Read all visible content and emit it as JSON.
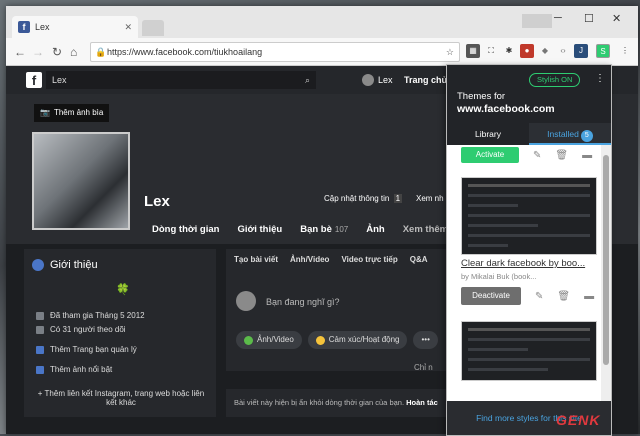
{
  "browser": {
    "tab_title": "Lex",
    "url": "https://www.facebook.com/tiukhoailang"
  },
  "fb": {
    "search_value": "Lex",
    "user_name": "Lex",
    "home_label": "Trang chủ",
    "cover_button": "Thêm ảnh bìa",
    "profile_name": "Lex",
    "update_info": "Cập nhật thông tin",
    "update_info_count": "1",
    "view_more": "Xem nh",
    "tabs": [
      {
        "label": "Dòng thời gian"
      },
      {
        "label": "Giới thiệu"
      },
      {
        "label": "Bạn bè",
        "count": "107"
      },
      {
        "label": "Ảnh"
      },
      {
        "label": "Xem thêm ▾"
      }
    ],
    "intro": {
      "heading": "Giới thiệu",
      "clover": "🍀",
      "joined": "Đã tham gia Tháng 5 2012",
      "followers": "Có 31 người theo dõi",
      "pages": "Thêm Trang bạn quản lý",
      "featured": "Thêm ảnh nổi bật",
      "links": "+ Thêm liên kết Instagram, trang web hoặc liên kết khác"
    },
    "composer": {
      "tabs": [
        "Tạo bài viết",
        "Ảnh/Video",
        "Video trực tiếp",
        "Q&A"
      ],
      "placeholder": "Bạn đang nghĩ gì?",
      "btn_photo": "Ảnh/Video",
      "btn_feeling": "Cảm xúc/Hoạt động",
      "btn_more": "•••",
      "privacy": "Chỉ n"
    },
    "hidden_note": "Bài viết này hiện bị ẩn khỏi dòng thời gian của bạn.",
    "hidden_done": "Hoàn tác"
  },
  "stylish": {
    "status": "Stylish ON",
    "title_line1": "Themes for",
    "title_line2": "www.facebook.com",
    "tab_library": "Library",
    "tab_installed": "Installed",
    "installed_count": "5",
    "activate": "Activate",
    "style_name": "Clear dark facebook by boo...",
    "style_author": "by Mikalai Buk (book...",
    "deactivate": "Deactivate",
    "footer": "Find more styles for this site"
  },
  "watermark": "GENK"
}
